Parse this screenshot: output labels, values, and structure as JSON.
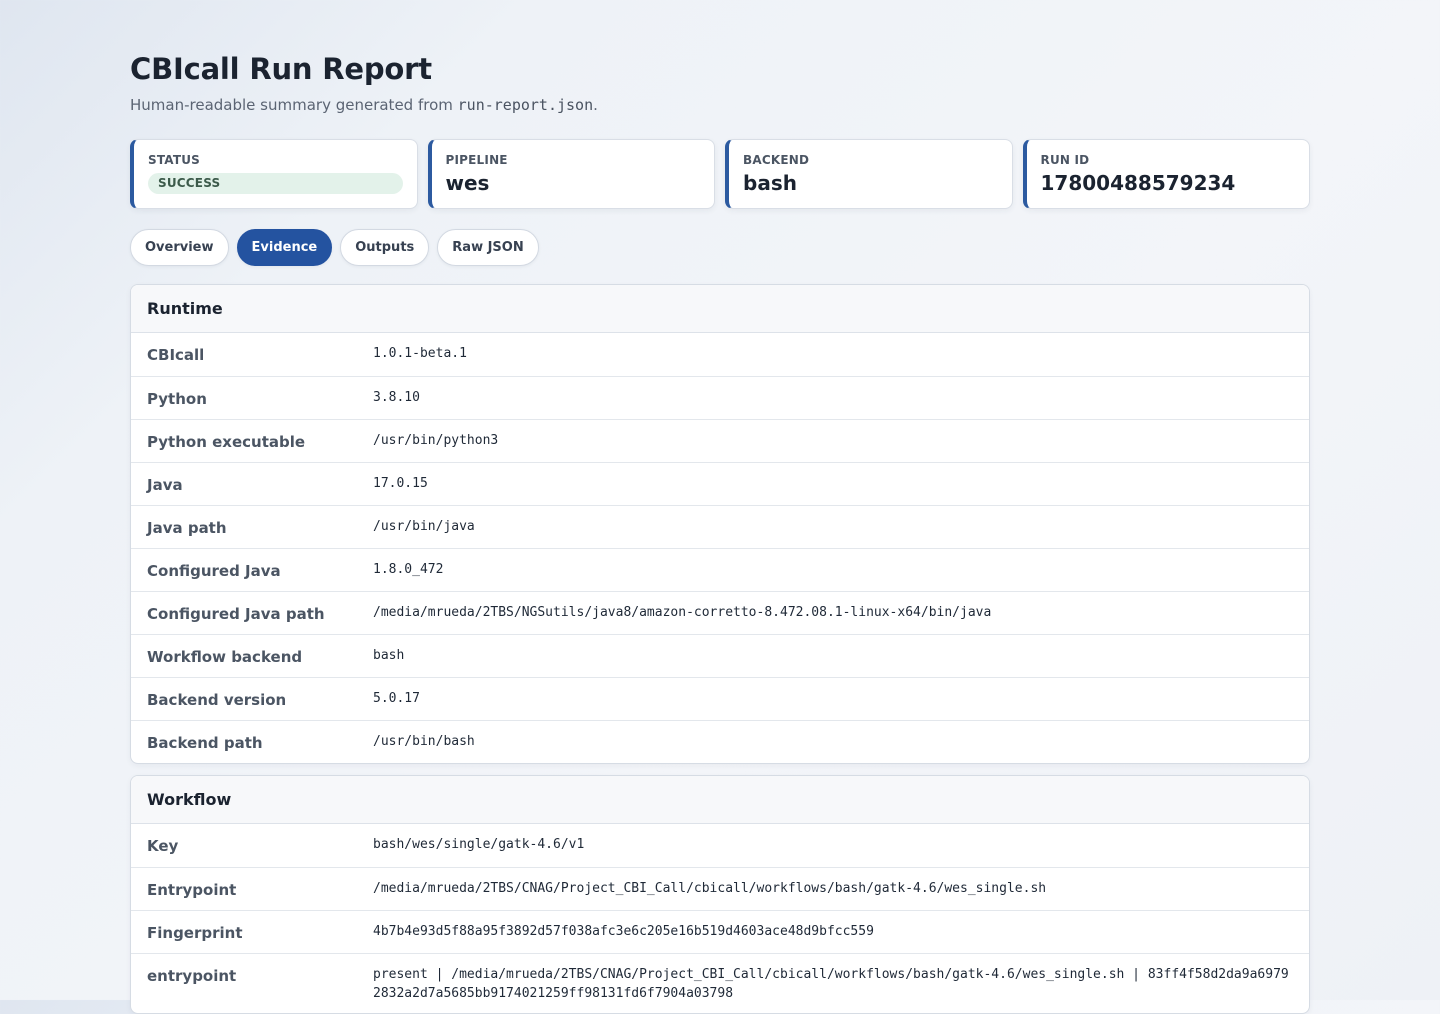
{
  "header": {
    "title": "CBIcall Run Report",
    "subtitle_prefix": "Human-readable summary generated from",
    "subtitle_file": "run-report.json",
    "subtitle_suffix": "."
  },
  "cards": {
    "status": {
      "label": "STATUS",
      "value": "SUCCESS"
    },
    "pipeline": {
      "label": "PIPELINE",
      "value": "wes"
    },
    "backend": {
      "label": "BACKEND",
      "value": "bash"
    },
    "run_id": {
      "label": "RUN ID",
      "value": "17800488579234"
    }
  },
  "tabs": [
    {
      "label": "Overview",
      "active": false
    },
    {
      "label": "Evidence",
      "active": true
    },
    {
      "label": "Outputs",
      "active": false
    },
    {
      "label": "Raw JSON",
      "active": false
    }
  ],
  "runtime": {
    "title": "Runtime",
    "rows": [
      {
        "key": "CBIcall",
        "value": "1.0.1-beta.1"
      },
      {
        "key": "Python",
        "value": "3.8.10"
      },
      {
        "key": "Python executable",
        "value": "/usr/bin/python3"
      },
      {
        "key": "Java",
        "value": "17.0.15"
      },
      {
        "key": "Java path",
        "value": "/usr/bin/java"
      },
      {
        "key": "Configured Java",
        "value": "1.8.0_472"
      },
      {
        "key": "Configured Java path",
        "value": "/media/mrueda/2TBS/NGSutils/java8/amazon-corretto-8.472.08.1-linux-x64/bin/java"
      },
      {
        "key": "Workflow backend",
        "value": "bash"
      },
      {
        "key": "Backend version",
        "value": "5.0.17"
      },
      {
        "key": "Backend path",
        "value": "/usr/bin/bash"
      }
    ]
  },
  "workflow": {
    "title": "Workflow",
    "rows": [
      {
        "key": "Key",
        "value": "bash/wes/single/gatk-4.6/v1"
      },
      {
        "key": "Entrypoint",
        "value": "/media/mrueda/2TBS/CNAG/Project_CBI_Call/cbicall/workflows/bash/gatk-4.6/wes_single.sh"
      },
      {
        "key": "Fingerprint",
        "value": "4b7b4e93d5f88a95f3892d57f038afc3e6c205e16b519d4603ace48d9bfcc559"
      },
      {
        "key": "entrypoint",
        "value": "present | /media/mrueda/2TBS/CNAG/Project_CBI_Call/cbicall/workflows/bash/gatk-4.6/wes_single.sh | 83ff4f58d2da9a69792832a2d7a5685bb9174021259ff98131fd6f7904a03798"
      }
    ]
  }
}
